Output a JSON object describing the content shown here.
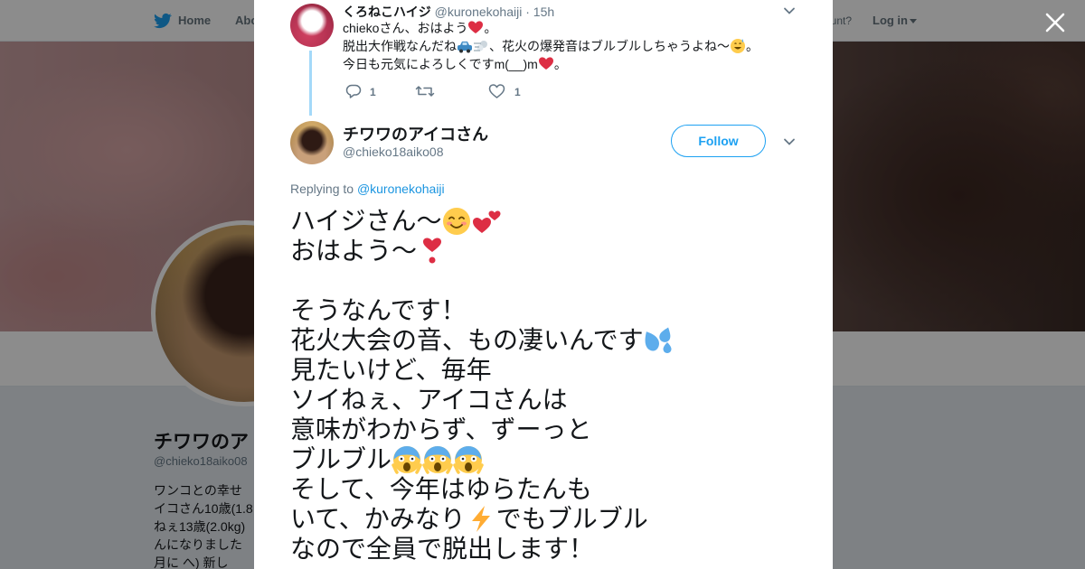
{
  "topbar": {
    "home_label": "Home",
    "about_label": "Abo",
    "account_text": "ccount?",
    "login_label": "Log in"
  },
  "profile": {
    "name": "チワワのア",
    "handle": "@chieko18aiko08",
    "bio_lines": [
      "ワンコとの幸せ",
      "イコさん10歳(1.8",
      "ねぇ13歳(2.0kg)",
      "んになりました",
      "月に   へ)    新し"
    ]
  },
  "reply_tweet": {
    "name": "くろねこハイジ",
    "handle": "@kuronekohaiji",
    "separator": "·",
    "time": "15h",
    "lines": [
      [
        "chiekoさん、おはよう",
        "。"
      ],
      [
        "脱出大作戦なんだね",
        "、花火の爆発音はブルブルしちゃうよね～",
        "。"
      ],
      [
        "今日も元気によろしくですm(__)m",
        "。"
      ]
    ],
    "reply_count": "1",
    "like_count": "1"
  },
  "main_tweet": {
    "name": "チワワのアイコさん",
    "handle": "@chieko18aiko08",
    "follow_label": "Follow",
    "replying_prefix": "Replying to",
    "replying_to": "@kuronekohaiji",
    "lines": [
      [
        "ハイジさん〜"
      ],
      [
        "おはよう〜"
      ],
      [
        ""
      ],
      [
        "そうなんです！"
      ],
      [
        "花火大会の音、もの凄いんです"
      ],
      [
        "見たいけど、毎年"
      ],
      [
        "ソイねぇ、アイコさんは"
      ],
      [
        "意味がわからず、ずーっと"
      ],
      [
        "ブルブル"
      ],
      [
        "そして、今年はゆらたんも"
      ],
      [
        "いて、かみなり",
        "でもブルブル"
      ],
      [
        "なので全員で脱出します！"
      ]
    ]
  },
  "icons": {
    "bird": "twitter-bird-icon",
    "close": "close-icon",
    "reply": "reply-icon",
    "retweet": "retweet-icon",
    "like": "heart-icon",
    "chevron": "chevron-down-icon"
  },
  "colors": {
    "brand_blue": "#1da1f2",
    "link_blue": "#1b95e0",
    "text": "#14171a",
    "secondary": "#657786",
    "thread_line": "#a4d9f9"
  }
}
